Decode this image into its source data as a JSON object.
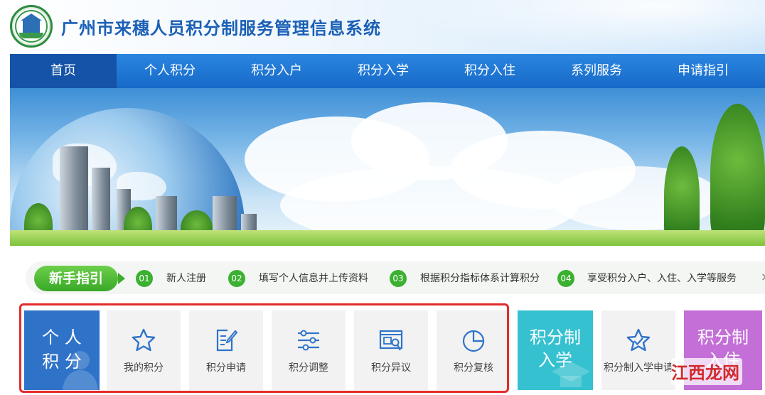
{
  "header": {
    "title": "广州市来穗人员积分制服务管理信息系统"
  },
  "nav": {
    "items": [
      {
        "label": "首页",
        "active": true
      },
      {
        "label": "个人积分"
      },
      {
        "label": "积分入户"
      },
      {
        "label": "积分入学"
      },
      {
        "label": "积分入住"
      },
      {
        "label": "系列服务"
      },
      {
        "label": "申请指引"
      }
    ]
  },
  "guide": {
    "tag": "新手指引",
    "steps": [
      {
        "num": "01",
        "text": "新人注册"
      },
      {
        "num": "02",
        "text": "填写个人信息并上传资料"
      },
      {
        "num": "03",
        "text": "根据积分指标体系计算积分"
      },
      {
        "num": "04",
        "text": "享受积分入户、入住、入学等服务"
      }
    ],
    "close": "×"
  },
  "tiles": {
    "personal": {
      "line1": "个 人",
      "line2": "积 分"
    },
    "items": [
      {
        "label": "我的积分",
        "icon": "star-icon"
      },
      {
        "label": "积分申请",
        "icon": "edit-document-icon"
      },
      {
        "label": "积分调整",
        "icon": "sliders-icon"
      },
      {
        "label": "积分异议",
        "icon": "inspect-document-icon"
      },
      {
        "label": "积分复核",
        "icon": "pie-chart-icon"
      }
    ],
    "school": {
      "line1": "积分制",
      "line2": "入学"
    },
    "school_apply": {
      "label": "积分制入学申请",
      "icon": "star-check-icon"
    },
    "housing": {
      "line1": "积分制",
      "line2": "入住"
    }
  },
  "watermark": {
    "text": "江西龙网"
  },
  "colors": {
    "nav_blue": "#1769c8",
    "tile_blue": "#2f73c9",
    "tile_teal": "#35c1d0",
    "tile_purple": "#c46fd8",
    "guide_green": "#3bb031",
    "highlight_red": "#e32b2b"
  }
}
